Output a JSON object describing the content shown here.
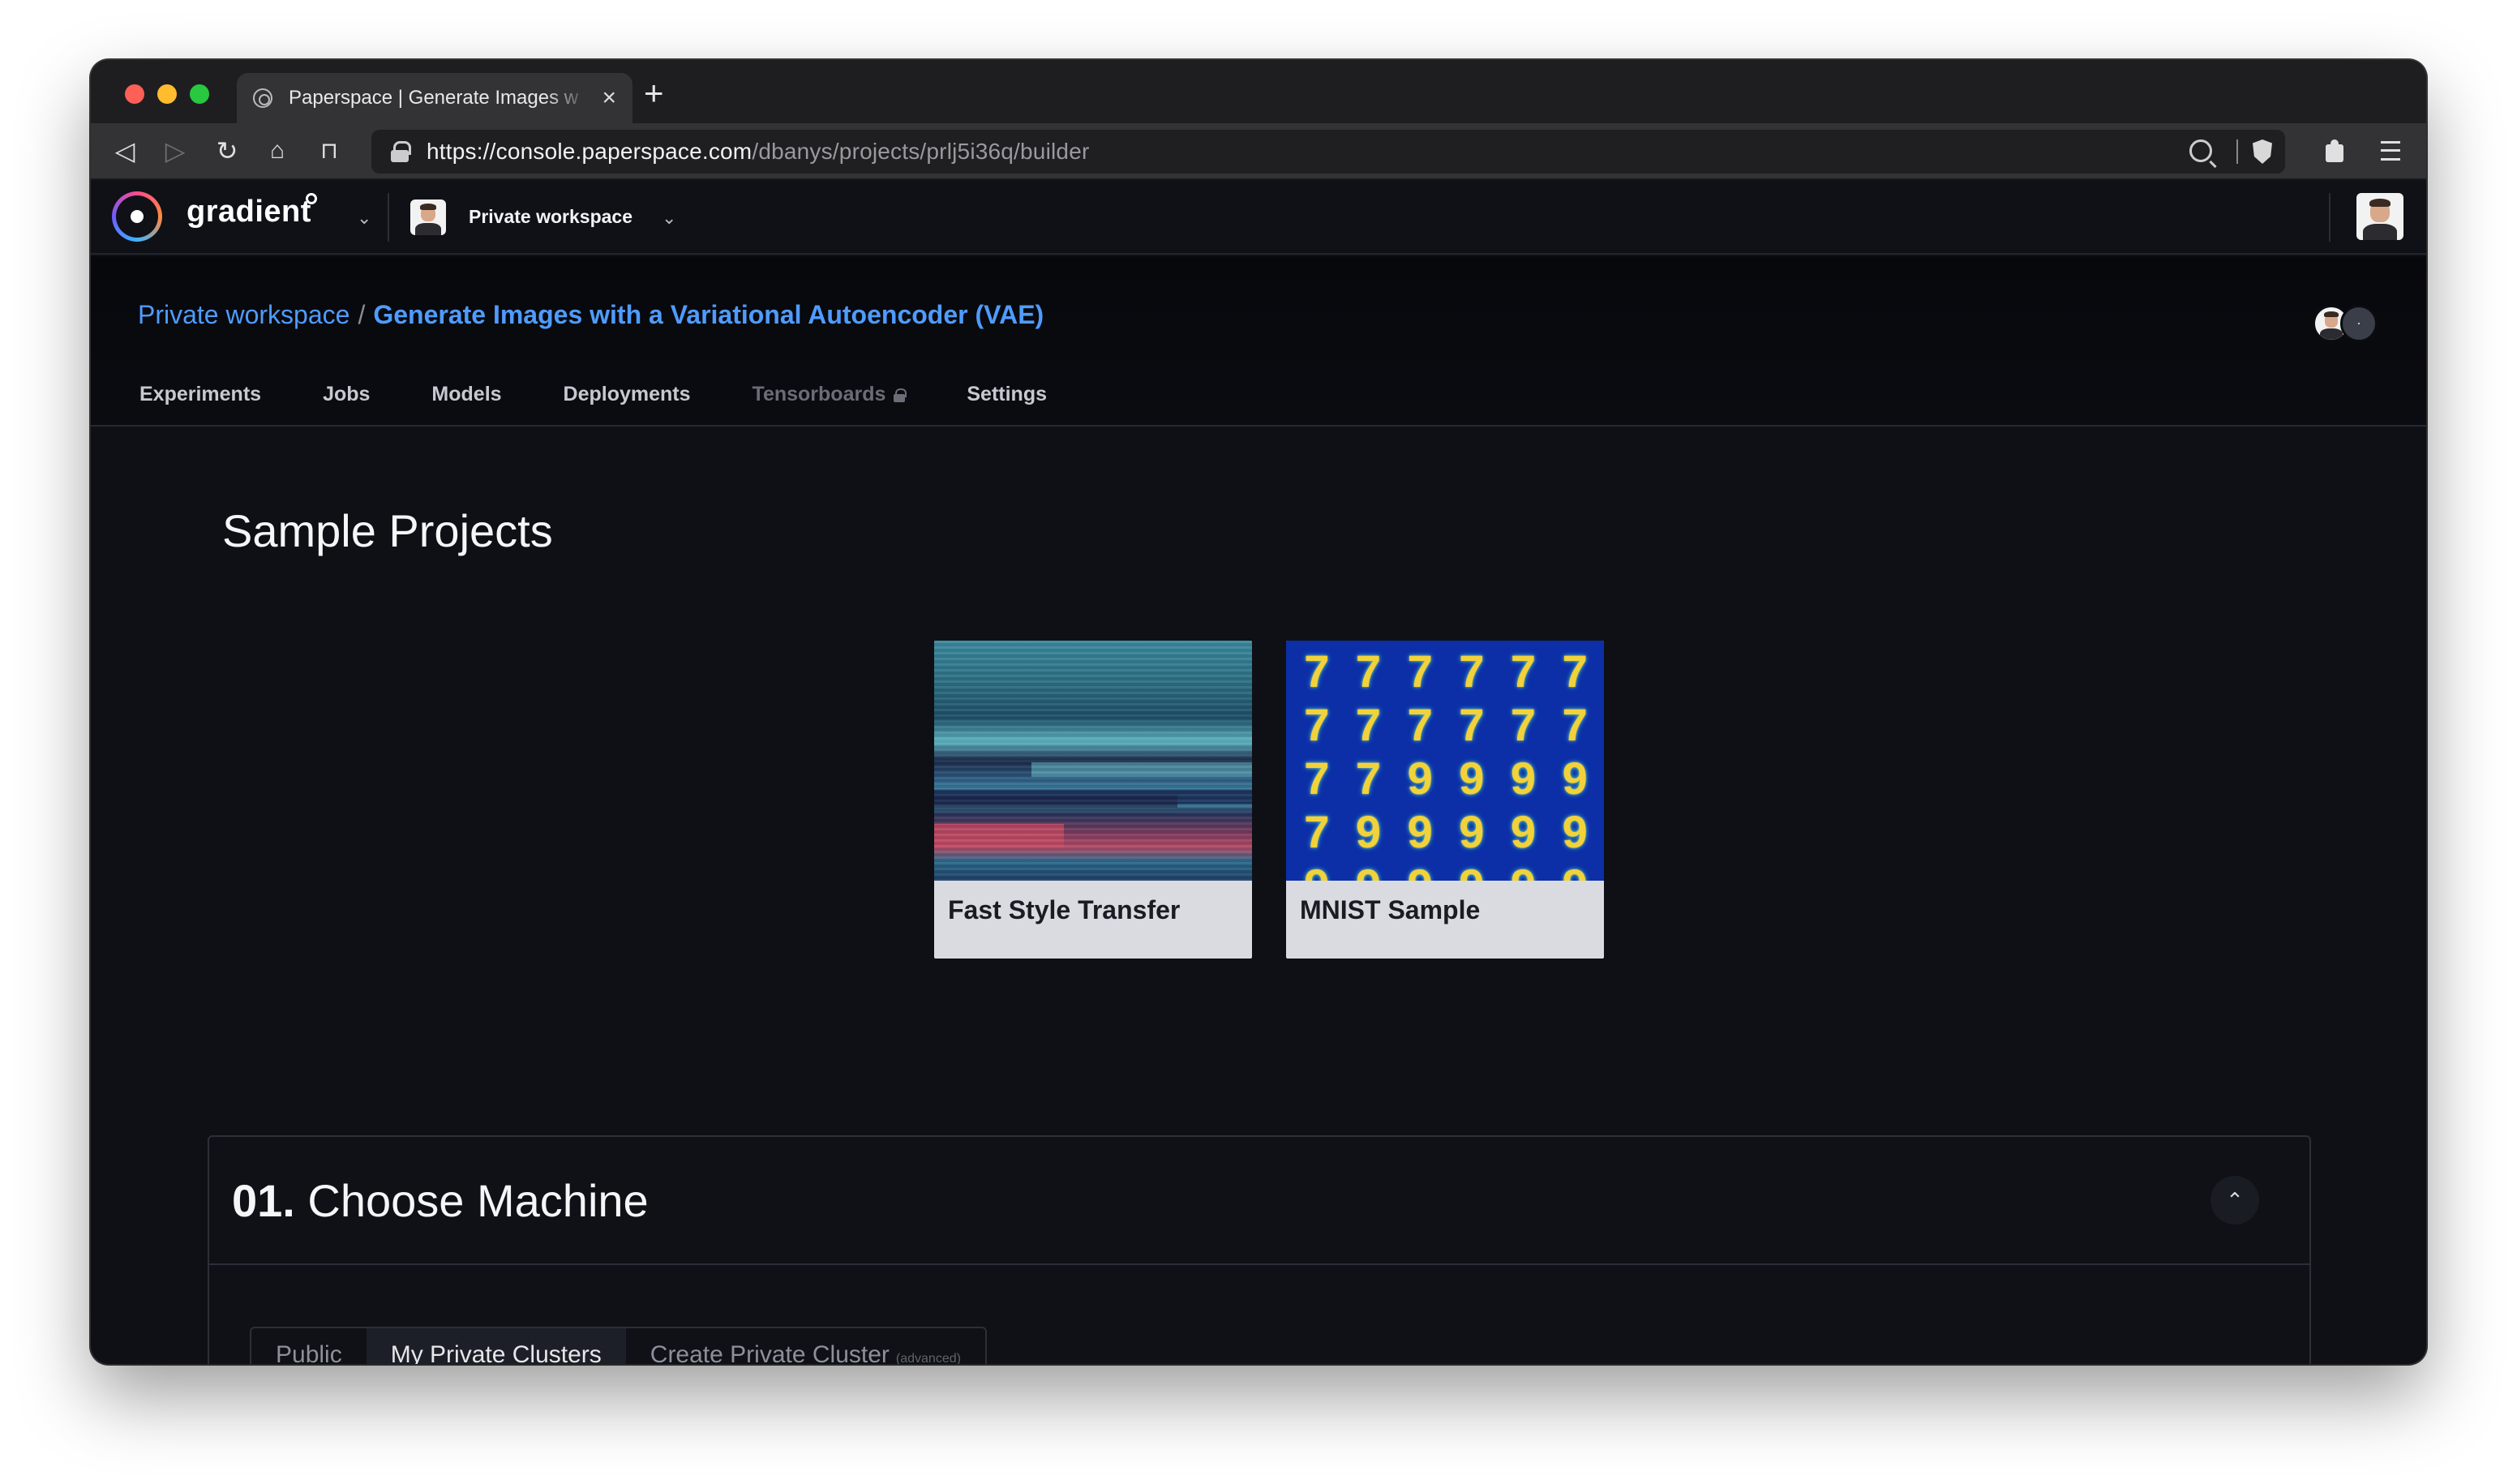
{
  "browser": {
    "tab_title": "Paperspace | Generate Images w",
    "new_tab": "+",
    "url_host": "https://console.paperspace.com",
    "url_path": "/dbanys/projects/prlj5i36q/builder"
  },
  "app": {
    "brand": "gradient",
    "workspace_label": "Private workspace"
  },
  "project": {
    "breadcrumb_workspace": "Private workspace",
    "breadcrumb_separator": "/",
    "breadcrumb_project": "Generate Images with a Variational Autoencoder (VAE)",
    "tabs": [
      {
        "label": "Experiments"
      },
      {
        "label": "Jobs"
      },
      {
        "label": "Models"
      },
      {
        "label": "Deployments"
      },
      {
        "label": "Tensorboards",
        "locked": true
      },
      {
        "label": "Settings"
      }
    ]
  },
  "sample_projects": {
    "title": "Sample Projects",
    "cards": [
      {
        "label": "Fast Style Transfer"
      },
      {
        "label": "MNIST Sample"
      }
    ]
  },
  "machine": {
    "step": "01.",
    "title": "Choose Machine",
    "tabs": [
      {
        "label": "Public"
      },
      {
        "label": "My Private Clusters",
        "active": true
      },
      {
        "label": "Create Private Cluster",
        "note": "(advanced)"
      }
    ]
  },
  "colors": {
    "accent_link": "#4f9bff",
    "page_bg": "#0e1016",
    "card_bg": "#d9dbe0"
  }
}
